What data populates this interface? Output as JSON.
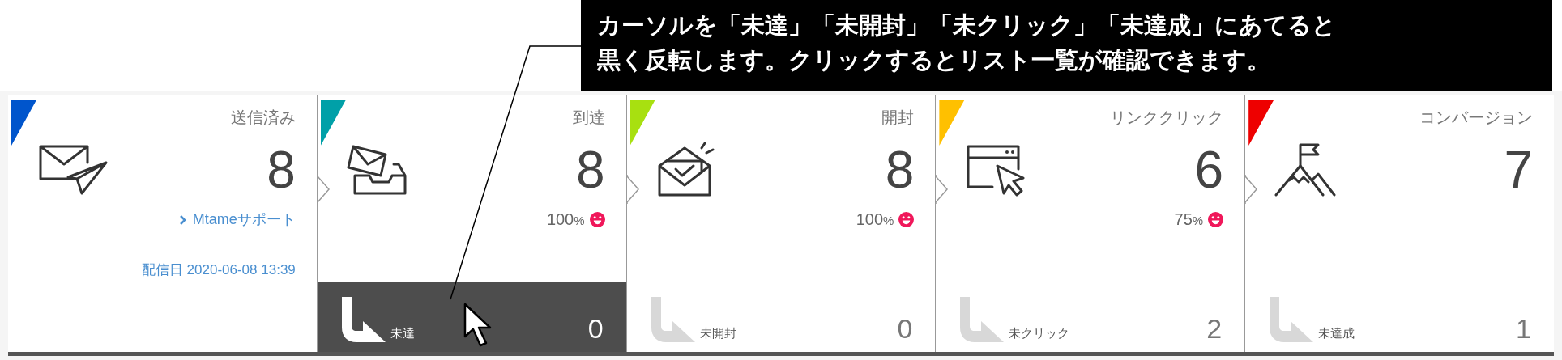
{
  "callout": {
    "lines": [
      "カーソルを「未達」「未開封」「未クリック」「未達成」にあてると",
      "黒く反転します。クリックするとリスト一覧が確認できます。"
    ]
  },
  "cards": [
    {
      "kind": "sent",
      "title": "送信済み",
      "color": "#0055cc",
      "count": "8",
      "link": "Mtameサポート",
      "date_label": "配信日",
      "date": "2020-06-08 13:39"
    },
    {
      "kind": "delivered",
      "title": "到達",
      "color": "#00a0a8",
      "count": "8",
      "percent": "100",
      "percent_unit": "%",
      "sub": {
        "label": "未達",
        "count": "0",
        "selected": true
      }
    },
    {
      "kind": "opened",
      "title": "開封",
      "color": "#a8e010",
      "count": "8",
      "percent": "100",
      "percent_unit": "%",
      "sub": {
        "label": "未開封",
        "count": "0",
        "selected": false
      }
    },
    {
      "kind": "click",
      "title": "リンククリック",
      "color": "#ffc000",
      "count": "6",
      "percent": "75",
      "percent_unit": "%",
      "sub": {
        "label": "未クリック",
        "count": "2",
        "selected": false
      }
    },
    {
      "kind": "conversion",
      "title": "コンバージョン",
      "color": "#ee0000",
      "count": "7",
      "sub": {
        "label": "未達成",
        "count": "1",
        "selected": false
      }
    }
  ]
}
